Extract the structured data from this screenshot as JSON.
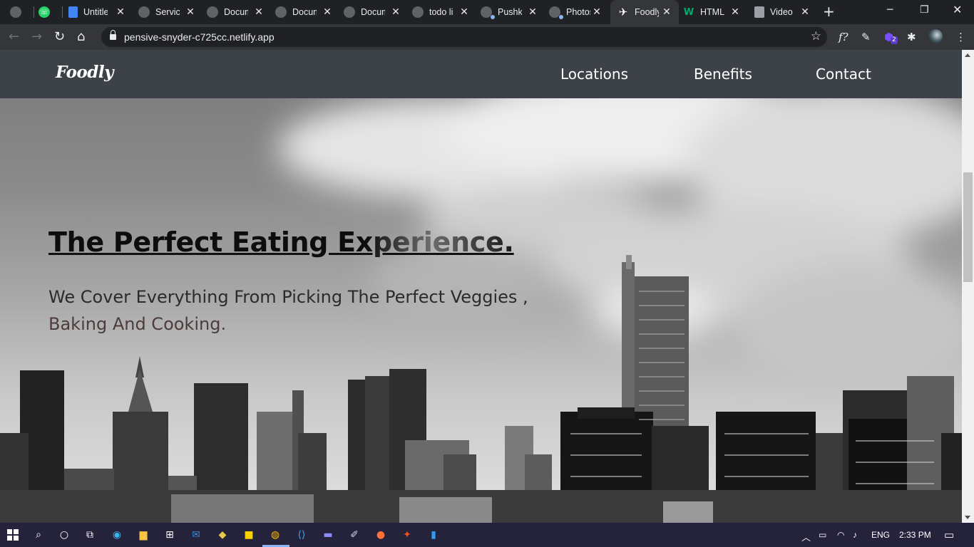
{
  "browser": {
    "tabs": [
      {
        "title": "",
        "icon": "globe-icon",
        "active": false
      },
      {
        "title": "",
        "icon": "whatsapp-icon",
        "active": false
      },
      {
        "title": "Untitled",
        "icon": "google-docs-icon",
        "active": false
      },
      {
        "title": "Services",
        "icon": "globe-icon",
        "active": false
      },
      {
        "title": "Document",
        "icon": "globe-icon",
        "active": false
      },
      {
        "title": "Document",
        "icon": "globe-icon",
        "active": false
      },
      {
        "title": "Document",
        "icon": "globe-icon",
        "active": false
      },
      {
        "title": "todo list",
        "icon": "globe-icon",
        "active": false
      },
      {
        "title": "Pushkar",
        "icon": "globe-icon",
        "active": false
      },
      {
        "title": "Photos",
        "icon": "globe-icon",
        "active": false
      },
      {
        "title": "Foodly",
        "icon": "swift-icon",
        "active": true
      },
      {
        "title": "HTML",
        "icon": "w3schools-icon",
        "active": false
      },
      {
        "title": "Video",
        "icon": "video-icon",
        "active": false
      }
    ],
    "address": "pensive-snyder-c725cc.netlify.app",
    "extension_badge": "2"
  },
  "site": {
    "logo": "Foodly",
    "nav": {
      "locations": "Locations",
      "benefits": "Benefits",
      "contact": "Contact"
    },
    "hero": {
      "title": "The Perfect Eating Experience.",
      "subtitle_line1": "We Cover Everything From Picking The Perfect Veggies ,",
      "subtitle_line2": "Baking And Cooking."
    }
  },
  "taskbar": {
    "language": "ENG",
    "time": "2:33 PM"
  },
  "colors": {
    "navbar": "#3d4148",
    "chrome_dark": "#202124",
    "chrome_toolbar": "#35363a",
    "taskbar": "#25233c"
  }
}
